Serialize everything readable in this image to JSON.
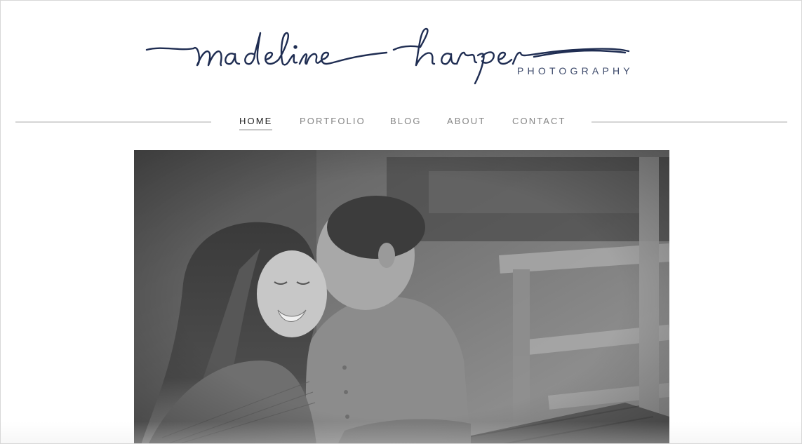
{
  "logo": {
    "script_text": "madeline harper",
    "subtitle": "PHOTOGRAPHY",
    "color": "#1f2d52"
  },
  "nav": {
    "items": [
      {
        "label": "HOME",
        "active": true
      },
      {
        "label": "PORTFOLIO",
        "active": false
      },
      {
        "label": "BLOG",
        "active": false
      },
      {
        "label": "ABOUT",
        "active": false
      },
      {
        "label": "CONTACT",
        "active": false
      }
    ]
  },
  "hero": {
    "alt": "couple-kiss-photo",
    "style": "black-and-white"
  },
  "colors": {
    "nav_text": "#858585",
    "nav_active": "#222222",
    "divider": "#d5d5d5"
  }
}
